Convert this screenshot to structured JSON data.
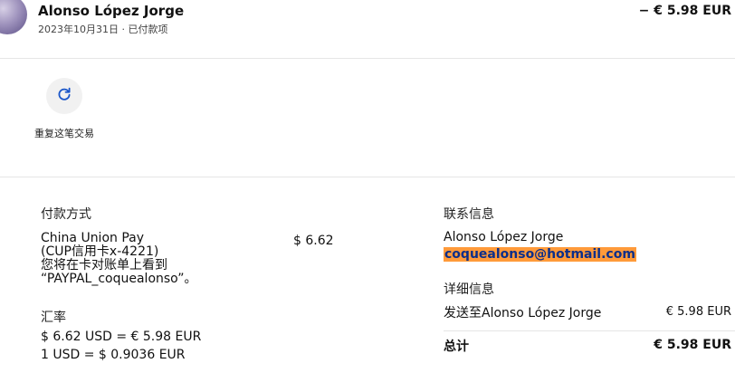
{
  "header": {
    "name": "Alonso López Jorge",
    "date_status": "2023年10月31日 · 已付款项",
    "amount": "− € 5.98 EUR"
  },
  "actions": {
    "repeat_icon": "refresh-icon",
    "repeat_label": "重复这笔交易"
  },
  "payment": {
    "title": "付款方式",
    "method_line1": "China Union Pay",
    "method_line2": "(CUP信用卡x-4221)",
    "method_line3": "您将在卡对账单上看到",
    "method_line4": "“PAYPAL_coquealonso”。",
    "amount": "$ 6.62"
  },
  "exchange": {
    "title": "汇率",
    "line1": "$ 6.62 USD = € 5.98 EUR",
    "line2": "1 USD = $ 0.9036 EUR"
  },
  "contact": {
    "title": "联系信息",
    "name": "Alonso López Jorge",
    "email": "coquealonso@hotmail.com"
  },
  "details": {
    "title": "详细信息",
    "sent_to_label": "发送至Alonso López Jorge",
    "sent_to_amount": "€ 5.98 EUR",
    "total_label": "总计",
    "total_amount": "€ 5.98 EUR"
  },
  "colors": {
    "email_highlight": "#ff9a3a",
    "email_text": "#0b2e8a",
    "repeat_icon": "#1a56c9"
  }
}
